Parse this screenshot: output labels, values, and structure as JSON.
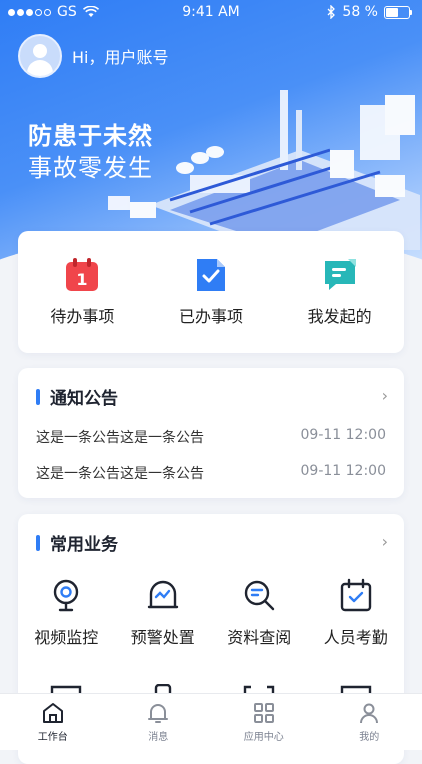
{
  "status_bar": {
    "carrier": "GS",
    "time": "9:41 AM",
    "battery": "58 %"
  },
  "user": {
    "greeting": "Hi，用户账号"
  },
  "hero": {
    "slogan_line1": "防患于未然",
    "slogan_line2": "事故零发生"
  },
  "tasks": [
    {
      "label": "待办事项",
      "icon": "calendar-icon",
      "color": "#f0454b"
    },
    {
      "label": "已办事项",
      "icon": "done-doc-icon",
      "color": "#2f7df5"
    },
    {
      "label": "我发起的",
      "icon": "chat-icon",
      "color": "#27b7b8"
    }
  ],
  "notice": {
    "title": "通知公告",
    "items": [
      {
        "text": "这是一条公告这是一条公告",
        "time": "09-11 12:00"
      },
      {
        "text": "这是一条公告这是一条公告",
        "time": "09-11 12:00"
      }
    ]
  },
  "business": {
    "title": "常用业务",
    "items": [
      {
        "label": "视频监控",
        "icon": "camera-icon"
      },
      {
        "label": "预警处置",
        "icon": "alarm-icon"
      },
      {
        "label": "资料查阅",
        "icon": "search-doc-icon"
      },
      {
        "label": "人员考勤",
        "icon": "attendance-icon"
      }
    ]
  },
  "tabbar": [
    {
      "label": "工作台",
      "icon": "home-icon",
      "active": true
    },
    {
      "label": "消息",
      "icon": "bell-icon",
      "active": false
    },
    {
      "label": "应用中心",
      "icon": "apps-icon",
      "active": false
    },
    {
      "label": "我的",
      "icon": "profile-icon",
      "active": false
    }
  ],
  "colors": {
    "primary": "#2f7df5",
    "accent_red": "#f0454b",
    "accent_teal": "#27b7b8",
    "background": "#f2f4f8"
  }
}
